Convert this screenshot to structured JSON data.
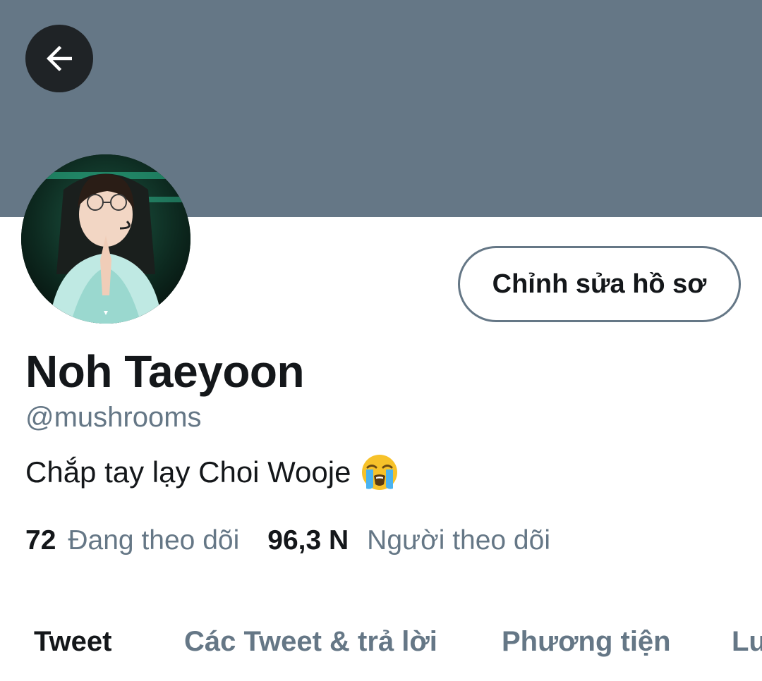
{
  "header": {
    "back_icon": "arrow-left-icon",
    "banner_color": "#657786"
  },
  "profile": {
    "edit_button_label": "Chỉnh sửa hồ sơ",
    "display_name": "Noh Taeyoon",
    "handle": "@mushrooms",
    "bio": "Chắp tay lạy Choi Wooje",
    "bio_emoji": "loudly-crying-face-emoji",
    "following_count": "72",
    "following_label": "Đang theo dõi",
    "followers_count": "96,3 N",
    "followers_label": "Người theo dõi"
  },
  "tabs": [
    {
      "label": "Tweet",
      "active": true
    },
    {
      "label": "Các Tweet & trả lời",
      "active": false
    },
    {
      "label": "Phương tiện",
      "active": false
    },
    {
      "label": "Lượt thích",
      "active": false
    }
  ],
  "colors": {
    "primary_text": "#14171a",
    "secondary_text": "#657786",
    "back_button_bg": "#1f2326"
  }
}
